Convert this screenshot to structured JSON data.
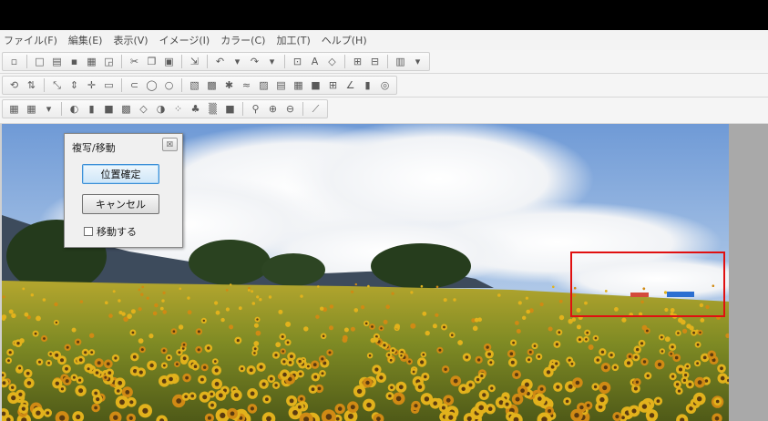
{
  "menu": [
    "ファイル(F)",
    "編集(E)",
    "表示(V)",
    "イメージ(I)",
    "カラー(C)",
    "加工(T)",
    "ヘルプ(H)"
  ],
  "toolbars": [
    [
      "doc-icon",
      "sep",
      "new-icon",
      "open-icon",
      "save-icon",
      "print-icon",
      "preview-icon",
      "sep",
      "cut-icon",
      "copy-icon",
      "paste-icon",
      "sep",
      "paste-special-icon",
      "sep",
      "undo-icon",
      "undo-dropdown-icon",
      "redo-icon",
      "redo-dropdown-icon",
      "sep",
      "crop-icon",
      "text-icon",
      "adjust-icon",
      "sep",
      "grid-icon",
      "frame-icon",
      "sep",
      "layers-icon",
      "layers-dropdown-icon"
    ],
    [
      "rotate-icon",
      "flip-icon",
      "sep",
      "resize-icon",
      "expand-icon",
      "center-icon",
      "fit-icon",
      "sep",
      "link-icon",
      "shape-icon",
      "circle-icon",
      "sep",
      "filter-icon",
      "tile-icon",
      "effect-icon",
      "wave-icon",
      "pattern-icon",
      "stamp-icon",
      "gradient-icon",
      "fill-icon",
      "table-icon",
      "pen-icon",
      "trash-icon",
      "target-icon"
    ],
    [
      "color1-icon",
      "color2-icon",
      "brush-icon",
      "sep",
      "gray-icon",
      "tone-icon",
      "contrast-icon",
      "mosaic-icon",
      "sharpen-icon",
      "blur-icon",
      "dots-icon",
      "sepia-icon",
      "noise-icon",
      "invert-icon",
      "sep",
      "zoom-icon",
      "zoom-in-icon",
      "zoom-out-icon",
      "sep",
      "eyedropper-icon"
    ]
  ],
  "dialog": {
    "title": "複写/移動",
    "close_label": "☒",
    "confirm_label": "位置確定",
    "cancel_label": "キャンセル",
    "move_label": "移動する",
    "move_checked": false
  },
  "colors": {
    "selection": "#e01010",
    "accent": "#3c8fd6"
  }
}
